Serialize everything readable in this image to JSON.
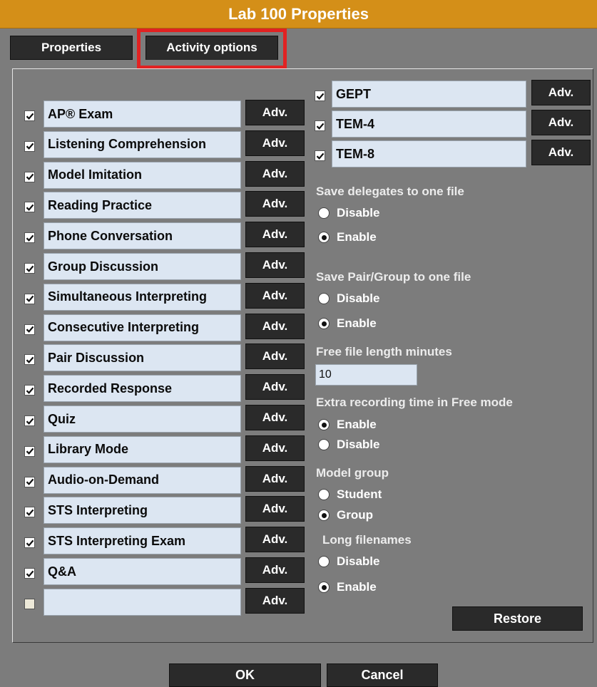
{
  "window": {
    "title": "Lab 100 Properties"
  },
  "tabs": {
    "properties": "Properties",
    "activity_options": "Activity options"
  },
  "activities": [
    {
      "label": "AP® Exam",
      "checked": true
    },
    {
      "label": "Listening Comprehension",
      "checked": true
    },
    {
      "label": "Model Imitation",
      "checked": true
    },
    {
      "label": "Reading Practice",
      "checked": true
    },
    {
      "label": "Phone Conversation",
      "checked": true
    },
    {
      "label": "Group Discussion",
      "checked": true
    },
    {
      "label": "Simultaneous Interpreting",
      "checked": true
    },
    {
      "label": "Consecutive Interpreting",
      "checked": true
    },
    {
      "label": "Pair Discussion",
      "checked": true
    },
    {
      "label": "Recorded Response",
      "checked": true
    },
    {
      "label": "Quiz",
      "checked": true
    },
    {
      "label": "Library Mode",
      "checked": true
    },
    {
      "label": "Audio-on-Demand",
      "checked": true
    },
    {
      "label": "STS Interpreting",
      "checked": true
    },
    {
      "label": "STS Interpreting Exam",
      "checked": true
    },
    {
      "label": "Q&A",
      "checked": true
    },
    {
      "label": "",
      "checked": false
    }
  ],
  "exams": [
    {
      "label": "GEPT",
      "checked": true
    },
    {
      "label": "TEM-4",
      "checked": true
    },
    {
      "label": "TEM-8",
      "checked": true
    }
  ],
  "adv_label": "Adv.",
  "settings": {
    "save_delegates": {
      "label": "Save delegates to one file",
      "options": [
        "Disable",
        "Enable"
      ],
      "selected": "Enable"
    },
    "save_pair_group": {
      "label": "Save Pair/Group to one file",
      "options": [
        "Disable",
        "Enable"
      ],
      "selected": "Enable"
    },
    "free_file_length": {
      "label": "Free file length minutes",
      "value": "10"
    },
    "extra_recording": {
      "label": "Extra recording time in Free mode",
      "options": [
        "Enable",
        "Disable"
      ],
      "selected": "Enable"
    },
    "model_group": {
      "label": "Model group",
      "options": [
        "Student",
        "Group"
      ],
      "selected": "Group"
    },
    "long_filenames": {
      "label": "Long filenames",
      "options": [
        "Disable",
        "Enable"
      ],
      "selected": "Enable"
    }
  },
  "buttons": {
    "restore": "Restore",
    "ok": "OK",
    "cancel": "Cancel"
  },
  "colors": {
    "title_bar": "#d48f18",
    "background": "#7c7c7c",
    "highlight": "#e12222",
    "field": "#dce6f2",
    "button": "#2a2a2a"
  }
}
